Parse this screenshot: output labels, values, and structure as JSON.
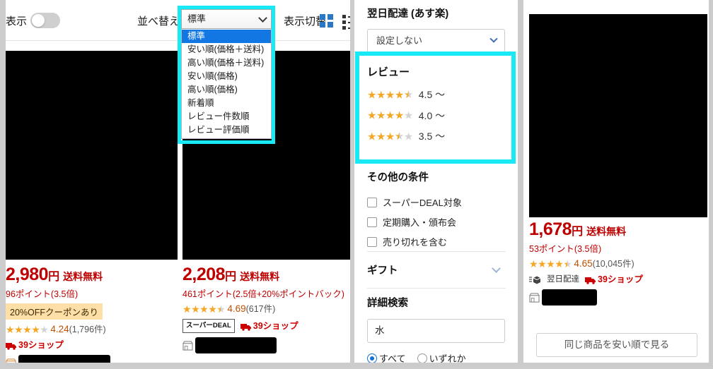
{
  "toolbar": {
    "display_label": "表示",
    "toggle_state": "off",
    "sort_label": "並べ替え",
    "sort_selected": "標準",
    "sort_options": [
      "標準",
      "安い順(価格＋送料)",
      "高い順(価格＋送料)",
      "安い順(価格)",
      "高い順(価格)",
      "新着順",
      "レビュー件数順",
      "レビュー評価順"
    ],
    "view_toggle_label": "表示切替",
    "grid_icon": "grid-view-icon",
    "list_icon": "list-view-icon",
    "accent_blue": "#2878c8",
    "highlight_cyan": "#18e9f5"
  },
  "products": [
    {
      "price": "2,980",
      "yen": "円",
      "shipping": "送料無料",
      "points": "96ポイント(3.5倍)",
      "coupon": "20%OFFクーポンあり",
      "stars_filled": 4,
      "stars_half": 0,
      "rating": "4.24",
      "review_count": "(1,796件)",
      "shop39": "39ショップ",
      "super_deal": null,
      "next_day": null
    },
    {
      "price": "2,208",
      "yen": "円",
      "shipping": "送料無料",
      "points": "461ポイント(2.5倍+20%ポイントバック)",
      "coupon": null,
      "stars_filled": 4,
      "stars_half": 1,
      "rating": "4.69",
      "review_count": "(617件)",
      "shop39": "39ショップ",
      "super_deal": "スーパーDEAL",
      "next_day": null
    }
  ],
  "featured_product": {
    "price": "1,678",
    "yen": "円",
    "shipping": "送料無料",
    "points": "53ポイント(3.5倍)",
    "stars_filled": 4,
    "stars_half": 1,
    "rating": "4.65",
    "review_count": "(10,045件)",
    "next_day": "翌日配達",
    "shop39": "39ショップ",
    "compare_button": "同じ商品を安い順で見る"
  },
  "filters": {
    "nextday_title": "翌日配達 (あす楽)",
    "nextday_value": "設定しない",
    "review_title": "レビュー",
    "review_options": [
      {
        "stars_filled": 4,
        "stars_half": 1,
        "label": "4.5 〜"
      },
      {
        "stars_filled": 4,
        "stars_half": 0,
        "label": "4.0 〜"
      },
      {
        "stars_filled": 3,
        "stars_half": 1,
        "label": "3.5 〜"
      }
    ],
    "other_title": "その他の条件",
    "other_checkboxes": [
      "スーパーDEAL対象",
      "定期購入・頒布会",
      "売り切れを含む"
    ],
    "gift_title": "ギフト",
    "detail_title": "詳細検索",
    "detail_input_value": "水",
    "detail_radio_all": "すべて",
    "detail_radio_any": "いずれか",
    "detail_radio_selected": "すべて"
  }
}
